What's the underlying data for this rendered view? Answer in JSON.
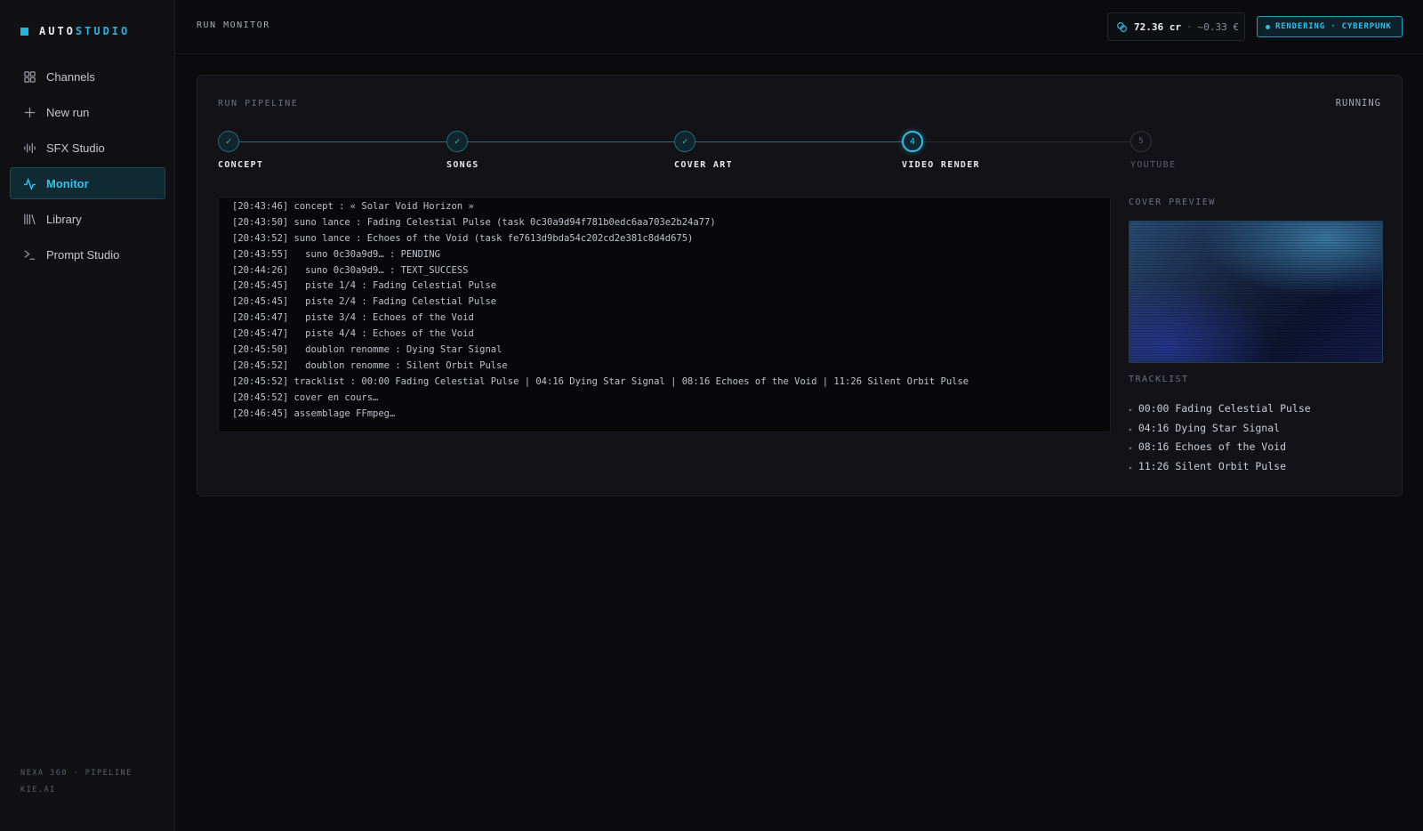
{
  "brand": {
    "part1": "AUTO",
    "part2": "STUDIO",
    "accent": "#1fb6e0"
  },
  "sidebar": {
    "items": [
      {
        "label": "Channels",
        "icon": "grid-icon",
        "active": false
      },
      {
        "label": "New run",
        "icon": "plus-icon",
        "active": false
      },
      {
        "label": "SFX Studio",
        "icon": "waveform-icon",
        "active": false
      },
      {
        "label": "Monitor",
        "icon": "activity-icon",
        "active": true
      },
      {
        "label": "Library",
        "icon": "library-icon",
        "active": false
      },
      {
        "label": "Prompt Studio",
        "icon": "terminal-icon",
        "active": false
      }
    ],
    "footer_line1": "NEXA 360 · PIPELINE",
    "footer_line2": "KIE.AI"
  },
  "header": {
    "title": "RUN MONITOR",
    "credits": "72.36 cr",
    "credits_sep": "·",
    "credits_eur": "~0.33 €",
    "status": "RENDERING · CYBERPUNK"
  },
  "pipeline": {
    "label": "RUN PIPELINE",
    "state": "RUNNING",
    "steps": [
      {
        "label": "CONCEPT",
        "mark": "✓",
        "status": "done"
      },
      {
        "label": "SONGS",
        "mark": "✓",
        "status": "done"
      },
      {
        "label": "COVER ART",
        "mark": "✓",
        "status": "done"
      },
      {
        "label": "VIDEO RENDER",
        "mark": "4",
        "status": "active"
      },
      {
        "label": "YOUTUBE",
        "mark": "5",
        "status": "todo"
      }
    ]
  },
  "log": [
    "[20:43:46] concept : « Solar Void Horizon »",
    "[20:43:50] suno lance : Fading Celestial Pulse (task 0c30a9d94f781b0edc6aa703e2b24a77)",
    "[20:43:52] suno lance : Echoes of the Void (task fe7613d9bda54c202cd2e381c8d4d675)",
    "[20:43:55]   suno 0c30a9d9… : PENDING",
    "[20:44:26]   suno 0c30a9d9… : TEXT_SUCCESS",
    "[20:45:45]   piste 1/4 : Fading Celestial Pulse",
    "[20:45:45]   piste 2/4 : Fading Celestial Pulse",
    "[20:45:47]   piste 3/4 : Echoes of the Void",
    "[20:45:47]   piste 4/4 : Echoes of the Void",
    "[20:45:50]   doublon renomme : Dying Star Signal",
    "[20:45:52]   doublon renomme : Silent Orbit Pulse",
    "[20:45:52] tracklist : 00:00 Fading Celestial Pulse | 04:16 Dying Star Signal | 08:16 Echoes of the Void | 11:26 Silent Orbit Pulse",
    "[20:45:52] cover en cours…",
    "[20:46:45] assemblage FFmpeg…"
  ],
  "cover_preview": {
    "label": "COVER PREVIEW"
  },
  "tracklist": {
    "label": "TRACKLIST",
    "bullet": "▸",
    "items": [
      "00:00 Fading Celestial Pulse",
      "04:16 Dying Star Signal",
      "08:16 Echoes of the Void",
      "11:26 Silent Orbit Pulse"
    ]
  }
}
